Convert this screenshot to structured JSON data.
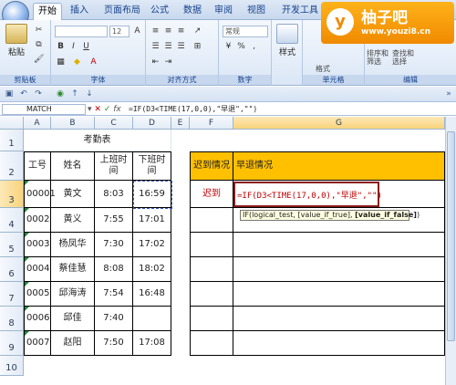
{
  "ribbon": {
    "tabs": [
      "开始",
      "插入",
      "页面布局",
      "公式",
      "数据",
      "审阅",
      "视图",
      "开发工具"
    ],
    "active_tab": 0,
    "groups": {
      "clipboard": "剪贴板",
      "font": "字体",
      "alignment": "对齐方式",
      "number": "数字",
      "cells": "单元格",
      "editing": "编辑"
    },
    "paste_label": "粘贴",
    "font_size": "12",
    "general": "常规",
    "style_label": "样式",
    "insert_label": "插入",
    "delete_label": "删除",
    "format_label": "格式",
    "sort_filter": "排序和\n筛选",
    "find_select": "查找和\n选择"
  },
  "watermark": {
    "logo": "y",
    "title": "柚子吧",
    "url": "www.youzi8.cn"
  },
  "formula_bar": {
    "name_box": "MATCH",
    "formula": "=IF(D3<TIME(17,0,0),\"早退\",\"\")"
  },
  "sheet": {
    "columns": [
      "A",
      "B",
      "C",
      "D",
      "E",
      "F",
      "G"
    ],
    "rows": [
      "1",
      "2",
      "3",
      "4",
      "5",
      "6",
      "7",
      "8",
      "9",
      "10"
    ],
    "title": "考勤表",
    "headers": [
      "工号",
      "姓名",
      "上班时\n间",
      "下班时\n间"
    ],
    "side_headers": [
      "迟到情况",
      "早退情况"
    ],
    "records": [
      [
        "00001",
        "黄文",
        "8:03",
        "16:59"
      ],
      [
        "0002",
        "黄义",
        "7:55",
        "17:01"
      ],
      [
        "0003",
        "杨凤华",
        "7:30",
        "17:02"
      ],
      [
        "0004",
        "蔡佳慧",
        "8:08",
        "18:02"
      ],
      [
        "0005",
        "邱海涛",
        "7:54",
        "16:48"
      ],
      [
        "0006",
        "邱佳",
        "7:40",
        ""
      ],
      [
        "0007",
        "赵阳",
        "7:50",
        "17:08"
      ]
    ],
    "f3": "迟到",
    "g3_edit": "=IF(D3<TIME(17,0,0),\"早退\",\"\")"
  },
  "tooltip": {
    "prefix": "IF(logical_test, [value_if_true], ",
    "bold": "[value_if_false]",
    "suffix": ")"
  },
  "colors": {
    "header_orange": "#ffc000",
    "edit_red": "#c00000",
    "accent": "#f08a00"
  }
}
